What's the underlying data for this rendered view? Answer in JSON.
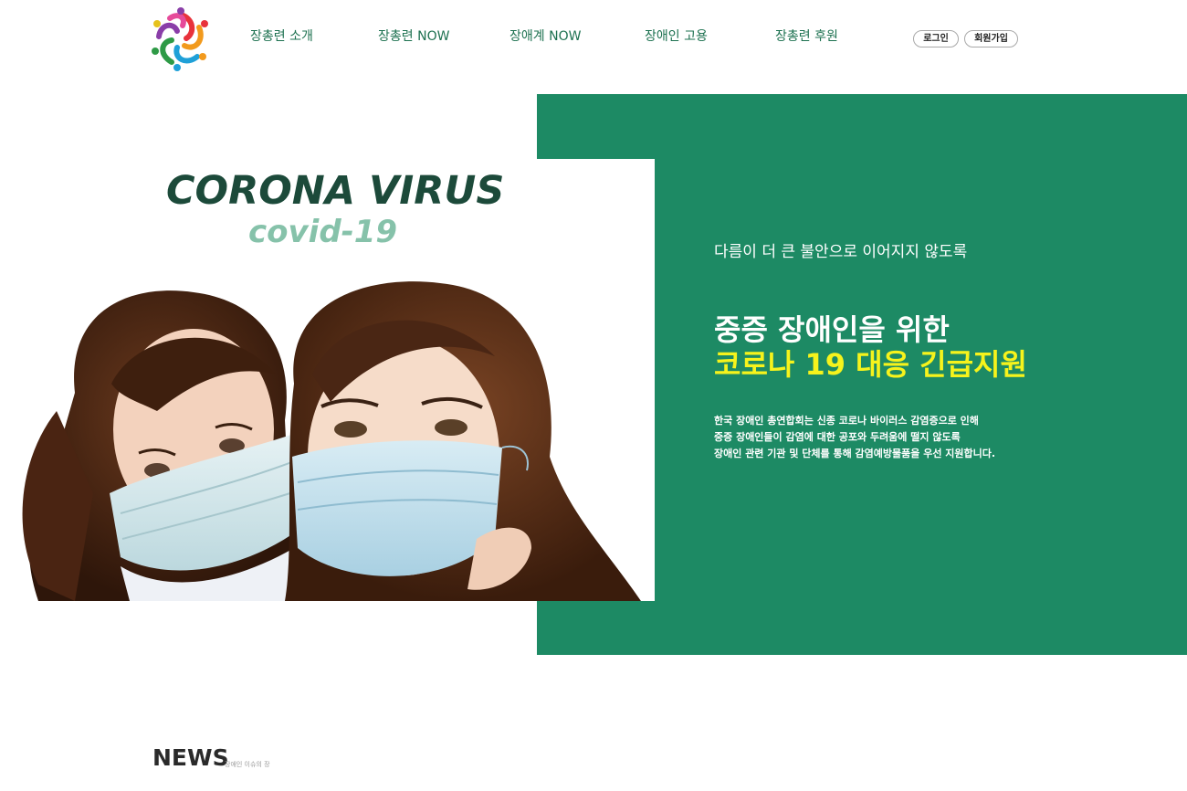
{
  "header": {
    "logo_icon": "colorful-people-circle-logo",
    "nav": [
      {
        "label": "장총련 소개"
      },
      {
        "label": "장총련 NOW"
      },
      {
        "label": "장애계 NOW"
      },
      {
        "label": "장애인 고용"
      },
      {
        "label": "장총련 후원"
      }
    ],
    "login_label": "로그인",
    "signup_label": "회원가입"
  },
  "hero": {
    "image_title": "CORONA VIRUS",
    "image_subtitle": "covid-19",
    "lead": "다름이 더 큰 불안으로 이어지지 않도록",
    "headline_line1": "중증 장애인을 위한",
    "headline_line2": "코로나 19 대응 긴급지원",
    "description": [
      "한국 장애인 총연합회는 신종 코로나 바이러스 감염증으로 인해",
      "중증 장애인들이 감염에 대한 공포와 두려움에 떨지 않도록",
      "장애인 관련 기관 및 단체를 통해 감염예방물품을 우선 지원합니다."
    ],
    "colors": {
      "panel": "#1d8a64",
      "headline_highlight": "#f6f31c",
      "title": "#1c4a3a",
      "subtitle": "#86c2aa"
    }
  },
  "news": {
    "title": "NEWS",
    "subtitle": "장애인 이슈의 장"
  }
}
